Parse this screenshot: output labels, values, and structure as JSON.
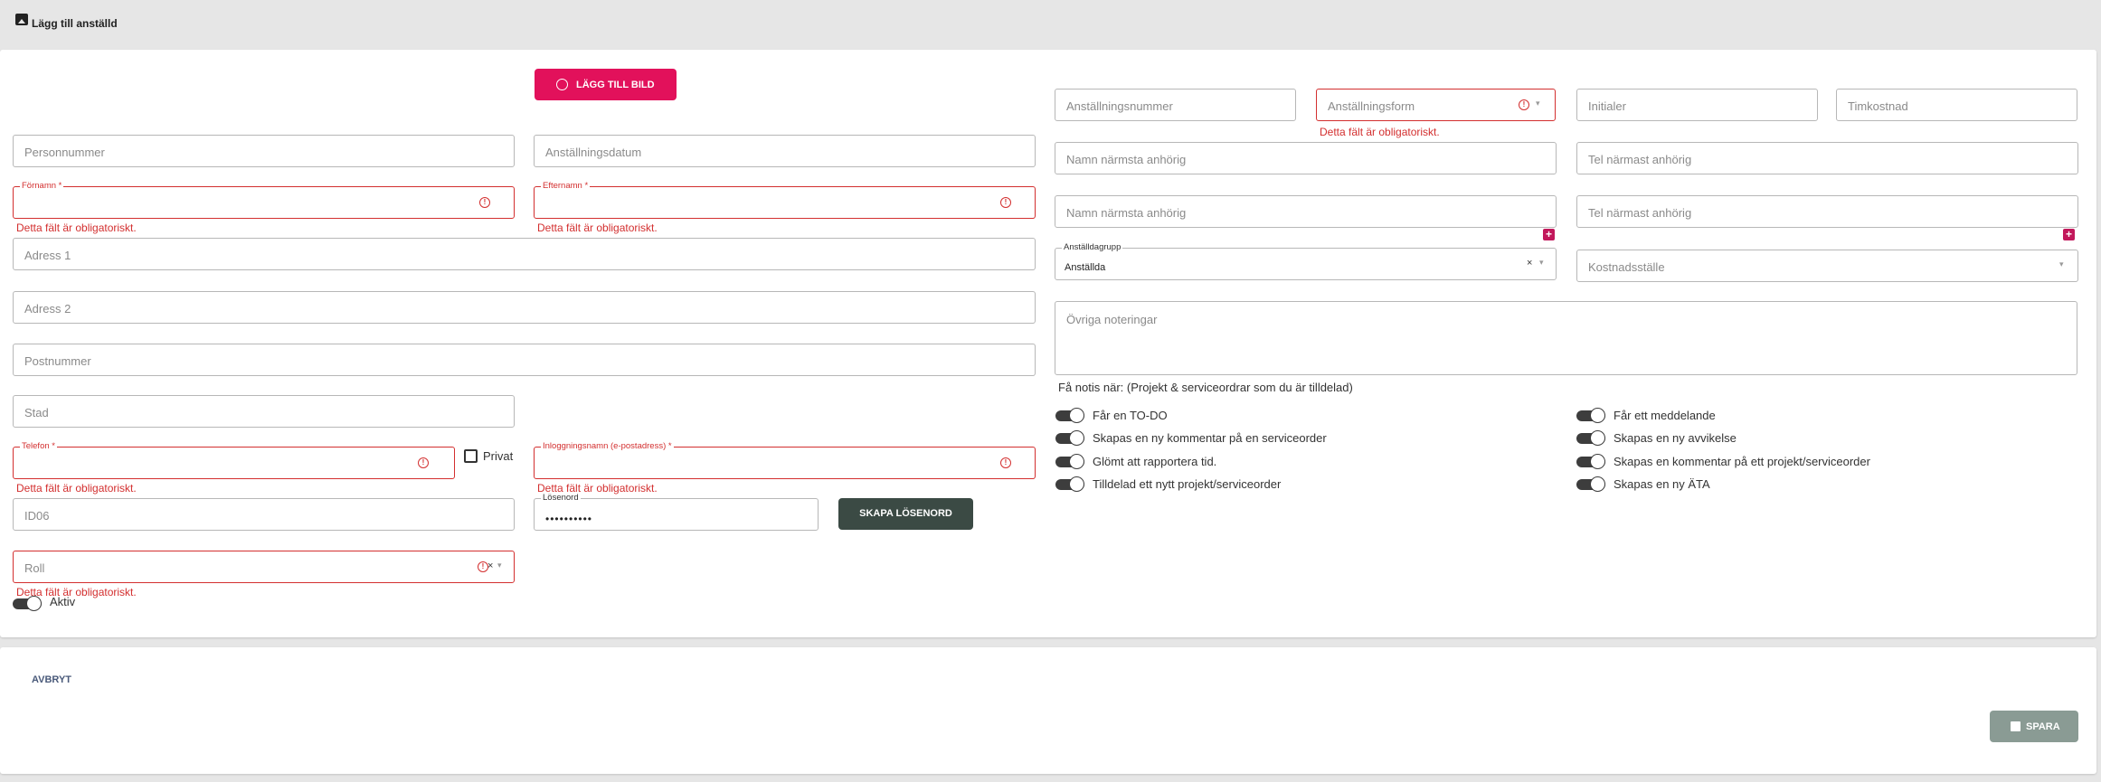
{
  "header": {
    "title": "Lägg till anställd"
  },
  "buttons": {
    "add_image": "LÄGG TILL BILD",
    "create_password": "SKAPA LÖSENORD",
    "cancel": "AVBRYT",
    "save": "SPARA"
  },
  "error_text": "Detta fält är obligatoriskt.",
  "fields": {
    "personnummer": "Personnummer",
    "anstallningsdatum": "Anställningsdatum",
    "fornamn": "Förnamn *",
    "efternamn": "Efternamn *",
    "adress1": "Adress 1",
    "adress2": "Adress 2",
    "postnummer": "Postnummer",
    "stad": "Stad",
    "telefon": "Telefon *",
    "privat": "Privat",
    "inloggningsnamn": "Inloggningsnamn (e-postadress) *",
    "id06": "ID06",
    "losenord_label": "Lösenord",
    "losenord_value": "••••••••••",
    "roll": "Roll",
    "aktiv": "Aktiv",
    "anstallningsnummer": "Anställningsnummer",
    "anstallningsform": "Anställningsform",
    "initialer": "Initialer",
    "timkostnad": "Timkostnad",
    "namn_narmsta_anhorig_1": "Namn närmsta anhörig",
    "tel_narmast_anhorig_1": "Tel närmast anhörig",
    "namn_narmsta_anhorig_2": "Namn närmsta anhörig",
    "tel_narmast_anhorig_2": "Tel närmast anhörig",
    "anstalldagrupp_label": "Anställdagrupp",
    "anstalldagrupp_value": "Anställda",
    "kostnadsstalle": "Kostnadsställe",
    "ovriga_noteringar": "Övriga noteringar"
  },
  "notifications": {
    "heading": "Få notis när: (Projekt & serviceordrar som du är tilldelad)",
    "left": [
      "Får en TO-DO",
      "Skapas en ny kommentar på en serviceorder",
      "Glömt att rapportera tid.",
      "Tilldelad ett nytt projekt/serviceorder"
    ],
    "right": [
      "Får ett meddelande",
      "Skapas en ny avvikelse",
      "Skapas en kommentar på ett projekt/serviceorder",
      "Skapas en ny ÄTA"
    ]
  },
  "colors": {
    "accent": "#e2115b",
    "error": "#d32f2f",
    "dark_button": "#3b4a44",
    "save_button": "#8a9b94"
  }
}
